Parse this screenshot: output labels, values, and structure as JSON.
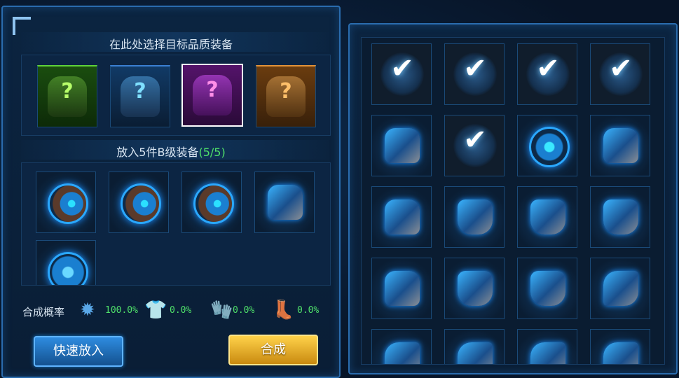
{
  "left_panel": {
    "target_title": "在此处选择目标品质装备",
    "target_slots": [
      {
        "quality": "green",
        "icon": "question-armor",
        "mark": "?",
        "color": "#5fd13a"
      },
      {
        "quality": "blue",
        "icon": "question-armor",
        "mark": "?",
        "color": "#3ab4ff"
      },
      {
        "quality": "purple",
        "icon": "question-armor",
        "mark": "?",
        "color": "#ff6bd9",
        "selected": true
      },
      {
        "quality": "orange",
        "icon": "question-armor",
        "mark": "?",
        "color": "#ffb04a"
      }
    ],
    "input_title_prefix": "放入5件B级装备",
    "input_count": "(5/5)",
    "input_slots": [
      "orb-armor",
      "orb-armor",
      "orb-armor",
      "helmet-armor",
      "ring-armor"
    ],
    "rate_label": "合成概率",
    "rates": [
      {
        "icon": "gear-icon",
        "value": "100.0%"
      },
      {
        "icon": "chest-icon",
        "value": "0.0%"
      },
      {
        "icon": "glove-icon",
        "value": "0.0%"
      },
      {
        "icon": "boots-icon",
        "value": "0.0%"
      }
    ],
    "quick_button": "快速放入",
    "compose_button": "合成"
  },
  "inventory": {
    "rows": [
      [
        "checked",
        "checked",
        "checked",
        "checked"
      ],
      [
        "helmet",
        "checked",
        "orb",
        "helmet"
      ],
      [
        "helmet",
        "chest",
        "chest",
        "chest"
      ],
      [
        "helmet",
        "chest",
        "chest",
        "glove"
      ],
      [
        "glove",
        "glove",
        "glove",
        "glove"
      ]
    ],
    "check_mark": "✔"
  }
}
